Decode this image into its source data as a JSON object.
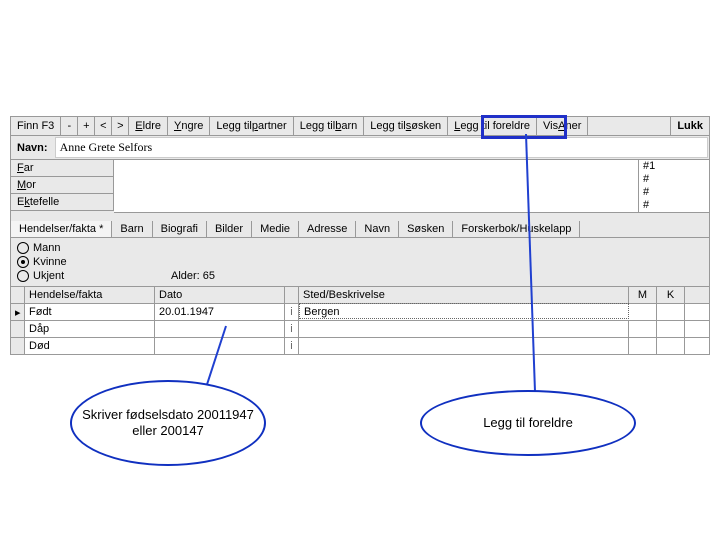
{
  "toolbar": {
    "finn": "Finn F3",
    "eldre": "Eldre",
    "yngre": "Yngre",
    "legg_partner": "Legg til partner",
    "legg_barn": "Legg til barn",
    "legg_sosken": "Legg til søsken",
    "legg_foreldre": "Legg til foreldre",
    "vis_aner": "Vis Aner",
    "lukk": "Lukk"
  },
  "name_label": "Navn:",
  "name_value": "Anne Grete Selfors",
  "relations": {
    "far": "Far",
    "mor": "Mor",
    "ektefelle": "Ektefelle"
  },
  "id_lines": [
    "#1",
    "#",
    "#",
    "#"
  ],
  "tabs": {
    "hendelser": "Hendelser/fakta *",
    "barn": "Barn",
    "biografi": "Biografi",
    "bilder": "Bilder",
    "medie": "Medie",
    "adresse": "Adresse",
    "navn": "Navn",
    "sosken": "Søsken",
    "forsker": "Forskerbok/Huskelapp"
  },
  "gender": {
    "mann": "Mann",
    "kvinne": "Kvinne",
    "ukjent": "Ukjent",
    "selected": "kvinne",
    "alder_label": "Alder: 65"
  },
  "grid": {
    "headers": {
      "ev": "Hendelse/fakta",
      "dt": "Dato",
      "pl": "Sted/Beskrivelse",
      "m": "M",
      "k": "K"
    },
    "rows": [
      {
        "marker": "▸",
        "ev": "Født",
        "dt": "20.01.1947",
        "w": "i",
        "pl": "Bergen",
        "active": true
      },
      {
        "marker": "",
        "ev": "Dåp",
        "dt": "",
        "w": "i",
        "pl": "",
        "active": false
      },
      {
        "marker": "",
        "ev": "Død",
        "dt": "",
        "w": "i",
        "pl": "",
        "active": false
      }
    ]
  },
  "callouts": {
    "c1": "Skriver fødselsdato 20011947 eller 200147",
    "c2": "Legg til foreldre"
  }
}
